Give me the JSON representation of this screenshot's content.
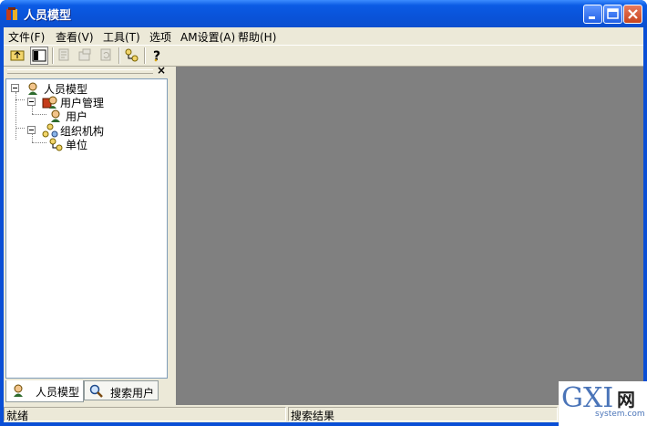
{
  "window": {
    "title": "人员模型"
  },
  "menu": [
    "文件(F)",
    "查看(V)",
    "工具(T)",
    "选项",
    "AM设置(A)",
    "帮助(H)"
  ],
  "toolbar": {
    "buttons": [
      "folder-up-icon",
      "panel-toggle-icon",
      "new-icon",
      "properties-icon",
      "refresh-icon",
      "org-link-icon",
      "help-icon"
    ]
  },
  "tree": {
    "root": "人员模型",
    "user_mgmt": "用户管理",
    "user": "用户",
    "org": "组织机构",
    "unit": "单位"
  },
  "tabs": {
    "model": "人员模型",
    "search": "搜索用户"
  },
  "status": {
    "left": "就绪",
    "right": "搜索结果"
  },
  "watermark": {
    "logo": "GXI",
    "cn": "网",
    "url": "system.com"
  },
  "colors": {
    "titlebar": "#0a53d9",
    "face": "#ece9d8",
    "mdi": "#808080",
    "tree_border": "#7f9db9"
  }
}
